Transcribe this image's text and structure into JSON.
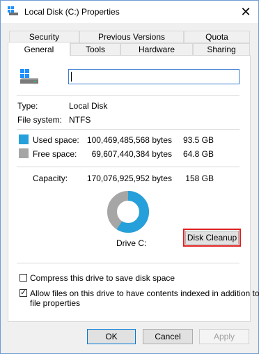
{
  "window": {
    "title": "Local Disk (C:) Properties"
  },
  "tabs": {
    "row1": [
      "Security",
      "Previous Versions",
      "Quota"
    ],
    "row2": [
      "General",
      "Tools",
      "Hardware",
      "Sharing"
    ],
    "active": "General"
  },
  "general": {
    "name_value": "",
    "type_label": "Type:",
    "type_value": "Local Disk",
    "fs_label": "File system:",
    "fs_value": "NTFS",
    "used_label": "Used space:",
    "used_bytes": "100,469,485,568 bytes",
    "used_size": "93.5 GB",
    "free_label": "Free space:",
    "free_bytes": "69,607,440,384 bytes",
    "free_size": "64.8 GB",
    "capacity_label": "Capacity:",
    "capacity_bytes": "170,076,925,952 bytes",
    "capacity_size": "158 GB",
    "drive_label": "Drive C:",
    "cleanup_button": "Disk Cleanup",
    "used_fraction": 0.5907,
    "colors": {
      "used": "#26a0da",
      "free": "#a6a6a6",
      "highlight": "#e02020"
    },
    "compress_label": "Compress this drive to save disk space",
    "compress_checked": false,
    "index_label_line1": "Allow files on this drive to have contents indexed in addition to",
    "index_label_line2": "file properties",
    "index_checked": true
  },
  "buttons": {
    "ok": "OK",
    "cancel": "Cancel",
    "apply": "Apply"
  },
  "icons": {
    "title": "drive-icon",
    "close": "close-icon",
    "drive": "drive-icon"
  }
}
